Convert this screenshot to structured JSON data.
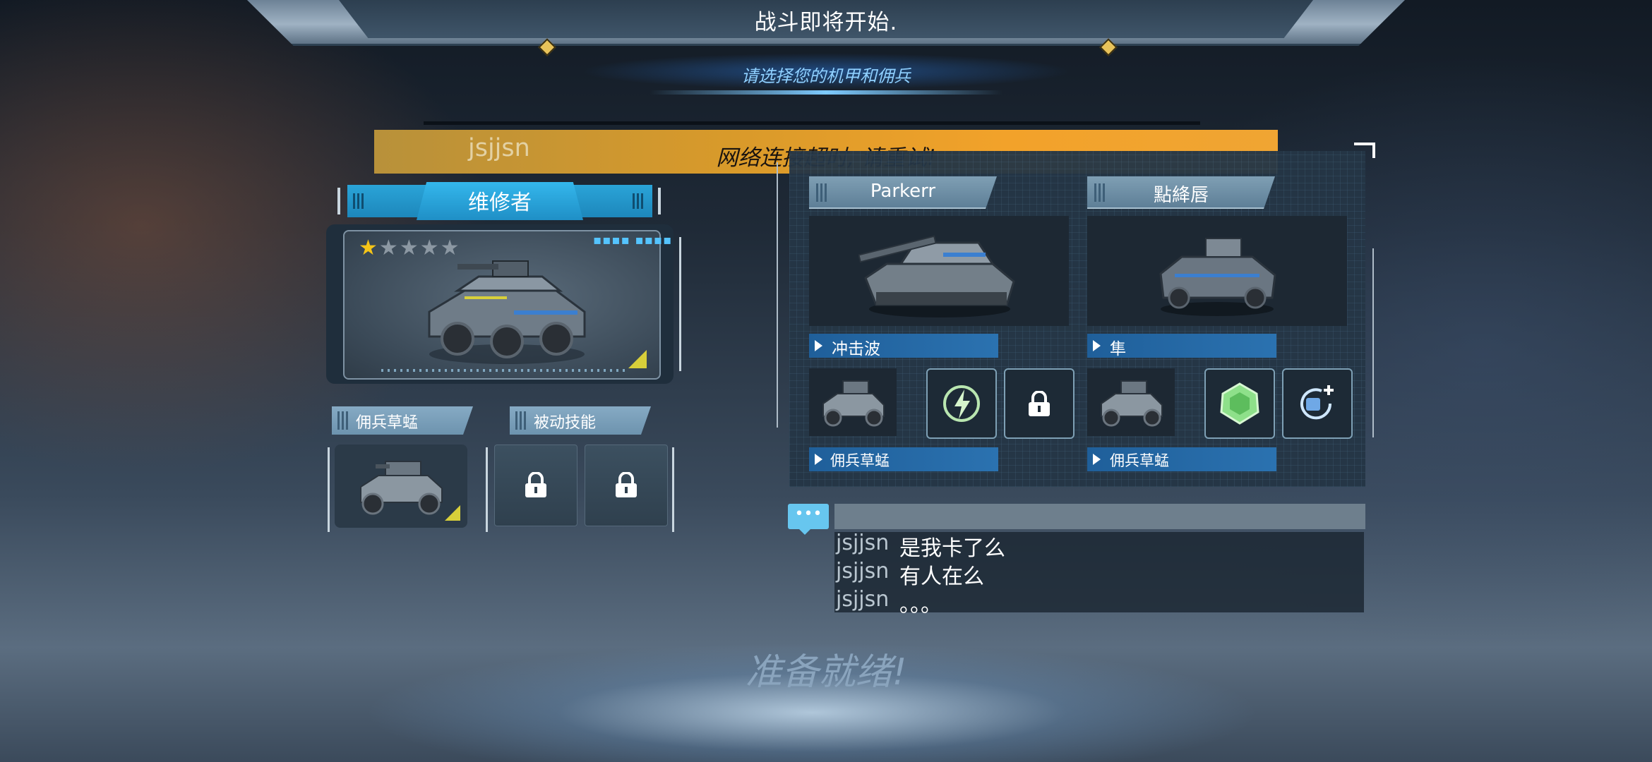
{
  "header": {
    "title": "战斗即将开始.",
    "subtitle": "请选择您的机甲和佣兵"
  },
  "alert": {
    "username": "jsjjsn",
    "message": "网络连接超时, 请重试!"
  },
  "player": {
    "role": "维修者",
    "stars_filled": 1,
    "stars_total": 5,
    "star_on": "★",
    "star_off": "★",
    "mercenary_tab": "佣兵草蜢",
    "passive_tab": "被动技能"
  },
  "teammates": [
    {
      "name": "Parkerr",
      "skill": "冲击波",
      "mercenary": "佣兵草蜢",
      "skill_icons": [
        "lightning-charge-icon",
        "lock-icon"
      ]
    },
    {
      "name": "點絳唇",
      "skill": "隼",
      "mercenary": "佣兵草蜢",
      "skill_icons": [
        "armor-shield-icon",
        "missile-plus-icon"
      ]
    }
  ],
  "chat": {
    "icon": "•••",
    "messages": [
      {
        "user": "jsjjsn",
        "text": "是我卡了么"
      },
      {
        "user": "jsjjsn",
        "text": "有人在么"
      },
      {
        "user": "jsjjsn",
        "text": "。。。"
      }
    ]
  },
  "status": {
    "ready": "准备就绪!"
  },
  "colors": {
    "accent_blue": "#2aa4d8",
    "alert_orange": "#f0a533",
    "star_gold": "#f5c518"
  }
}
